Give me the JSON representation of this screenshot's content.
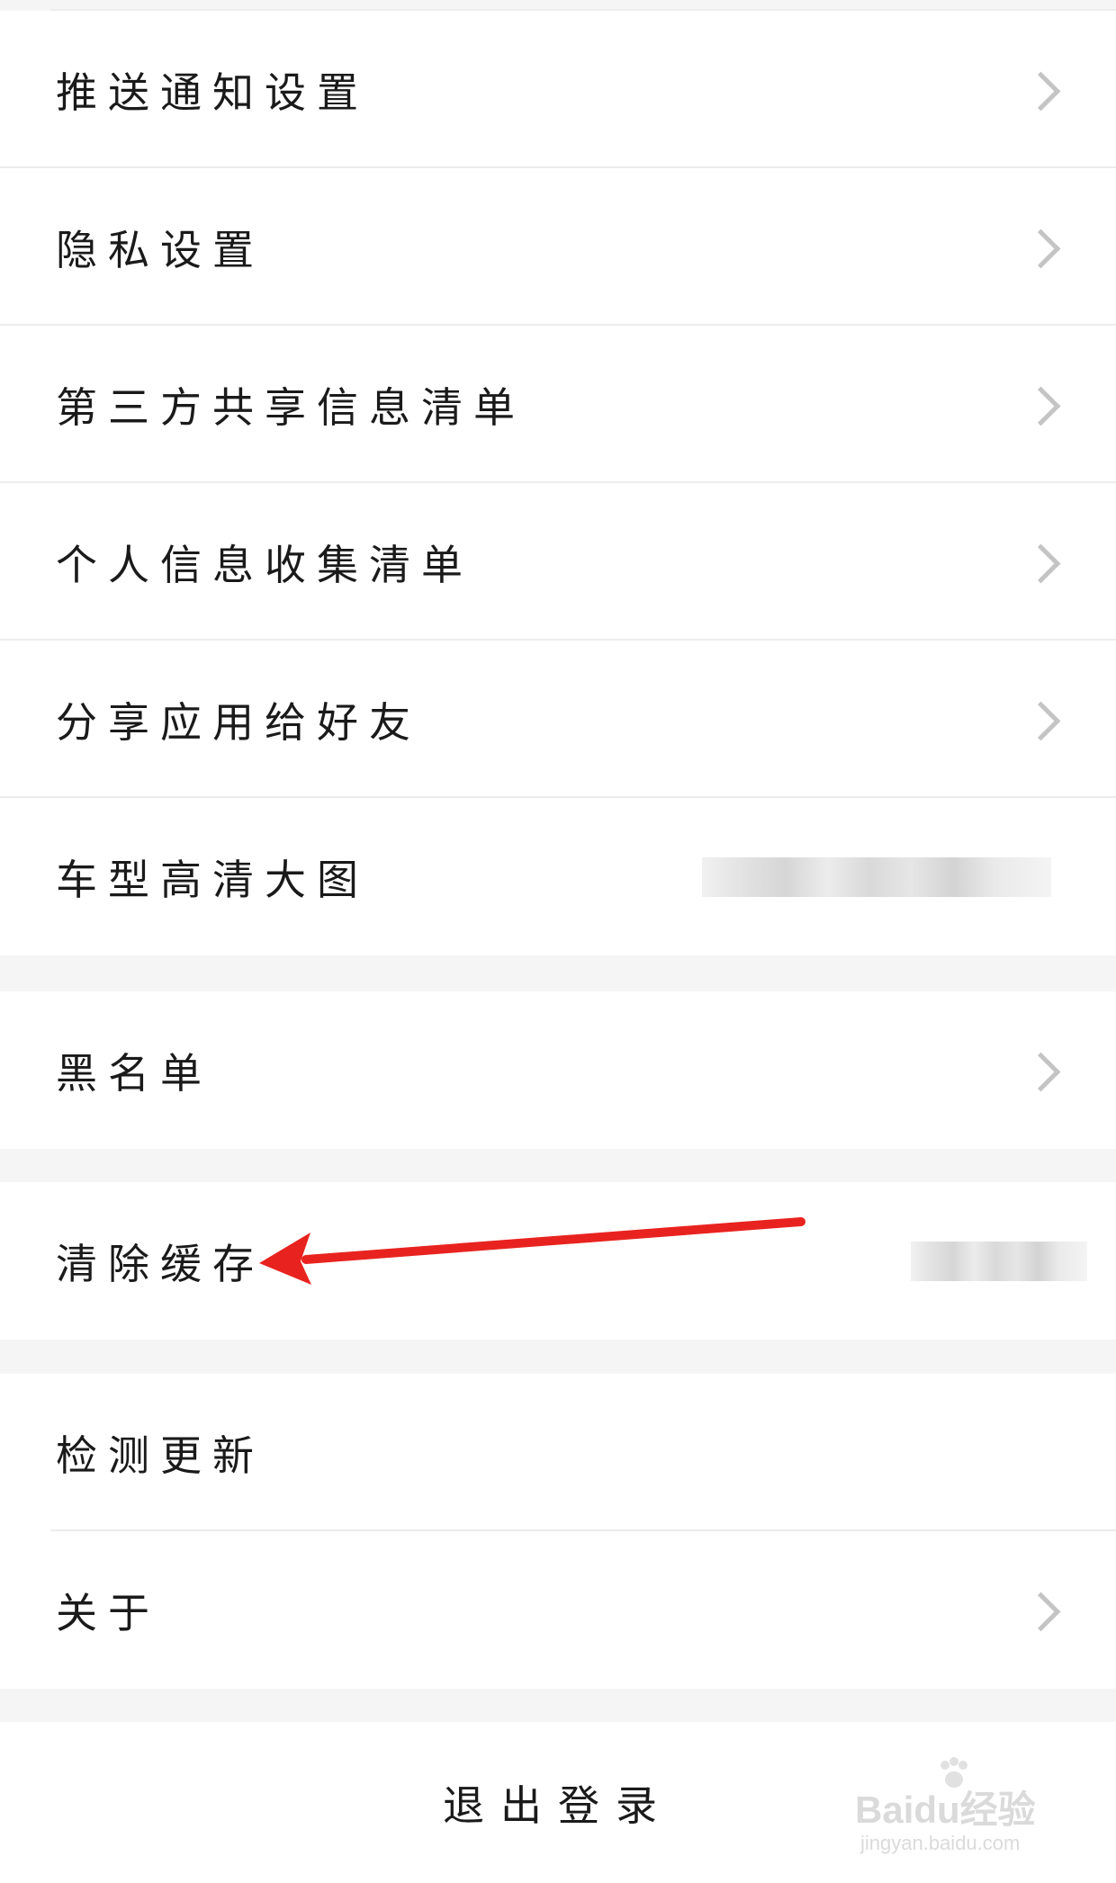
{
  "settings": {
    "push": {
      "label": "推送通知设置"
    },
    "privacy": {
      "label": "隐私设置"
    },
    "third_party": {
      "label": "第三方共享信息清单"
    },
    "personal_info": {
      "label": "个人信息收集清单"
    },
    "share_app": {
      "label": "分享应用给好友"
    },
    "car_images": {
      "label": "车型高清大图"
    },
    "blacklist": {
      "label": "黑名单"
    },
    "clear_cache": {
      "label": "清除缓存"
    },
    "check_update": {
      "label": "检测更新"
    },
    "about": {
      "label": "关于"
    }
  },
  "logout": {
    "label": "退出登录"
  },
  "annotation": {
    "color": "#e8231f"
  },
  "watermark": {
    "brand": "Baidu经验",
    "url": "jingyan.baidu.com"
  },
  "icons": {
    "row_chevron": "chevron-right-icon"
  }
}
